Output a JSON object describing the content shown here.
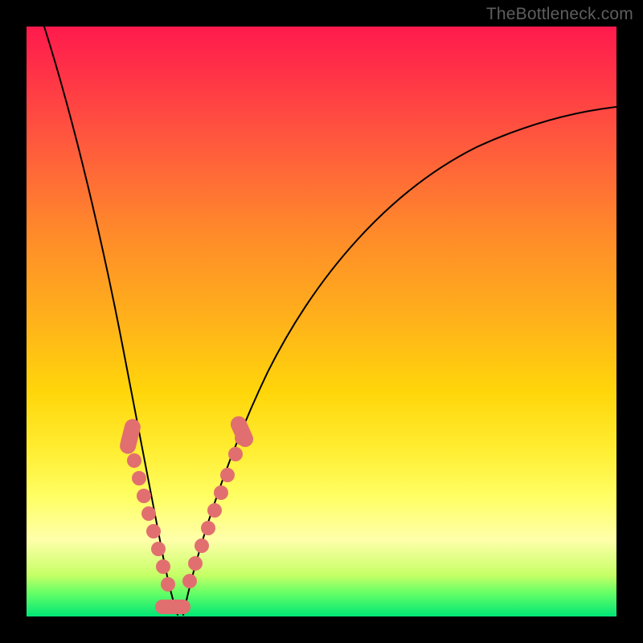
{
  "watermark": "TheBottleneck.com",
  "colors": {
    "bead": "#e26f6f",
    "curve_stroke": "#000000",
    "frame_bg_top": "#ff1a4d",
    "frame_bg_bottom": "#00e676",
    "page_bg": "#000000"
  },
  "chart_data": {
    "type": "line",
    "title": "",
    "xlabel": "",
    "ylabel": "",
    "x_range": [
      0,
      100
    ],
    "y_range": [
      0,
      100
    ],
    "notes": "Bottleneck-style V curve. y ≈ percentage bottleneck; minimum ≈ 0 near x≈25. Values estimated from pixel positions on a 734×734 plot area.",
    "series": [
      {
        "name": "curve_left",
        "x": [
          3,
          6,
          9,
          12,
          15,
          18,
          21,
          23,
          25
        ],
        "y": [
          100,
          82,
          65,
          50,
          36,
          24,
          14,
          5,
          0
        ]
      },
      {
        "name": "curve_right",
        "x": [
          25,
          27,
          30,
          34,
          40,
          48,
          58,
          70,
          85,
          100
        ],
        "y": [
          0,
          6,
          14,
          25,
          38,
          52,
          64,
          74,
          81,
          86
        ]
      }
    ],
    "beads_left": {
      "name": "left_arm_markers",
      "x": [
        17.5,
        18.5,
        19.3,
        20.0,
        20.8,
        21.6,
        22.3,
        23.0
      ],
      "y": [
        29.0,
        25.5,
        22.5,
        19.5,
        16.5,
        13.5,
        11.0,
        7.5
      ]
    },
    "beads_left_lozenge": {
      "name": "left_arm_elongated_marker",
      "x_range": [
        16.5,
        18.0
      ],
      "y_range": [
        33.0,
        27.5
      ]
    },
    "beads_right": {
      "name": "right_arm_markers",
      "x": [
        27.5,
        28.5,
        29.5,
        30.5,
        31.5,
        32.5,
        33.5,
        35.0,
        36.3
      ],
      "y": [
        6.5,
        9.5,
        12.5,
        15.5,
        18.5,
        21.0,
        24.0,
        28.0,
        31.0
      ]
    },
    "beads_right_lozenge": {
      "name": "right_arm_elongated_marker",
      "x_range": [
        35.5,
        37.2
      ],
      "y_range": [
        29.0,
        33.0
      ]
    },
    "beads_bottom_lozenge": {
      "name": "valley_elongated_marker",
      "x_range": [
        22.0,
        27.0
      ],
      "y_center": 1.5
    }
  }
}
